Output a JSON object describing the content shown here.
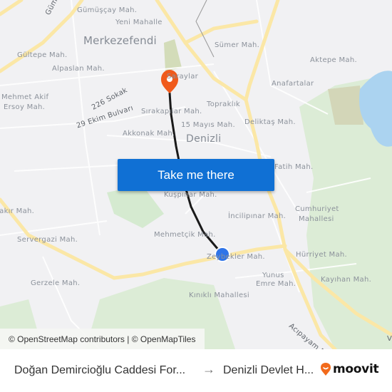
{
  "map": {
    "labels": {
      "gumuscay": "Gümüşçay Mah.",
      "yeni_mahalle": "Yeni Mahalle",
      "merkezefendi": "Merkezefendi",
      "gultepe": "Gültepe Mah.",
      "alpaslan": "Alpaslan Mah.",
      "mehmet_akif_1": "Mehmet Akif",
      "mehmet_akif_2": "Ersoy Mah.",
      "gumusler_road": "Gümüşler B.",
      "sokak_226": "226 Sokak",
      "ekim_29": "29 Ekim Bulvarı",
      "saraylar": "Saraylar",
      "sirakapilar": "Sırakapılar Mah.",
      "mayis_15": "15 Mayıs Mah.",
      "akkonak": "Akkonak Mah.",
      "denizli": "Denizli",
      "sumer": "Sümer Mah.",
      "aktepe": "Aktepe Mah.",
      "anafartalar": "Anafartalar",
      "topraklik": "Topraklık",
      "deliktas": "Deliktaş Mah.",
      "fatih": "Fatih Mah.",
      "kuspinar": "Kuşpınar Mah.",
      "incilipinar": "İncilipınar Mah.",
      "cumhuriyet_1": "Cumhuriyet",
      "cumhuriyet_2": "Mahallesi",
      "bahcelievler": "Zeybekler Mah.",
      "hurriyet": "Hürriyet Mah.",
      "mehmetcik": "Mehmetçik Mah.",
      "servergazi": "Servergazi Mah.",
      "bakir": "Bakır Mah.",
      "gerzele": "Gerzele Mah.",
      "yunus_1": "Yunus",
      "yunus_2": "Emre Mah.",
      "kinikli": "Kınıklı Mahallesi",
      "kayihan": "Kayıhan Mah.",
      "acipayam": "Acıpayam B.",
      "v_edge": "V"
    },
    "cta_label": "Take me there",
    "attribution": "© OpenStreetMap contributors | © OpenMapTiles",
    "colors": {
      "route": "#1a1a1a",
      "origin": "#2f74e8",
      "destination": "#f05a1c",
      "cta": "#1070d4",
      "water": "#abd3f0",
      "park": "#d5ead0",
      "major_road": "#fbe7a6"
    }
  },
  "footer": {
    "origin": "Doğan Demircioğlu Caddesi For...",
    "arrow": "→",
    "destination": "Denizli Devlet H...",
    "brand": "moovit"
  }
}
